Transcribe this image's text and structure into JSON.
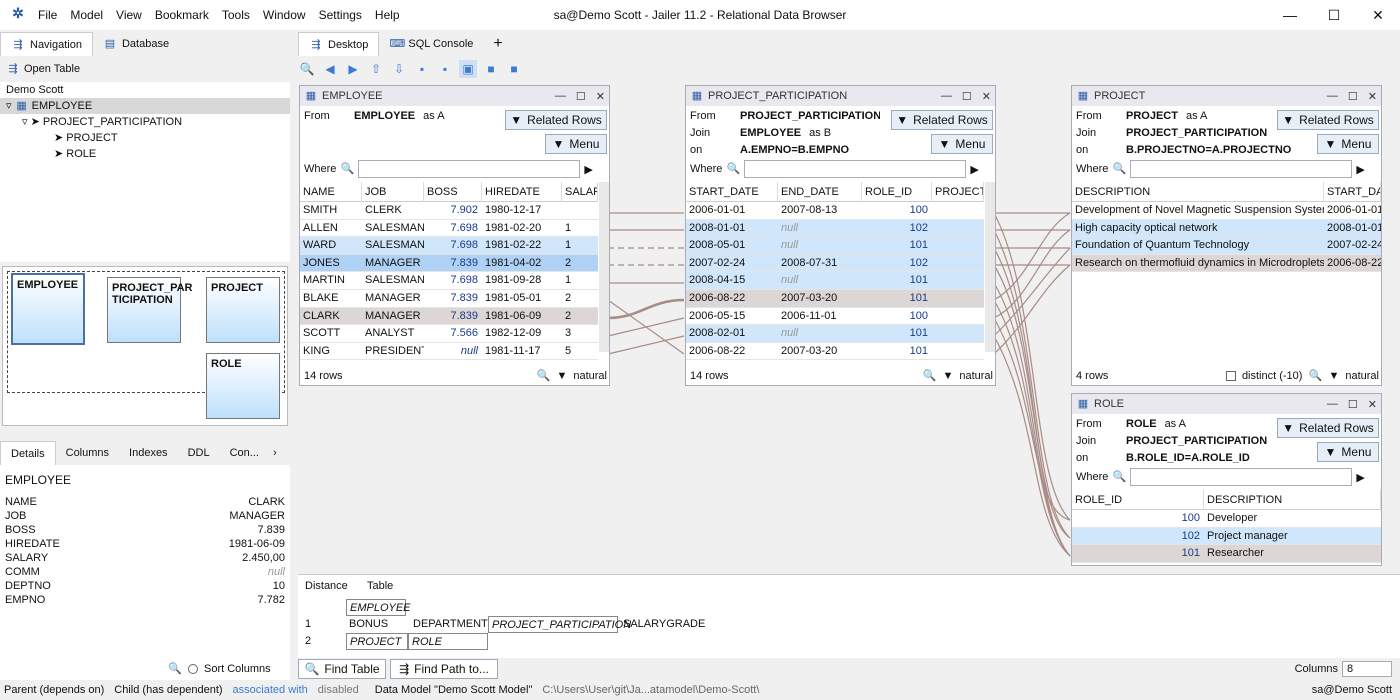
{
  "window": {
    "title": "sa@Demo Scott - Jailer 11.2 - Relational Data Browser",
    "menu": [
      "File",
      "Model",
      "View",
      "Bookmark",
      "Tools",
      "Window",
      "Settings",
      "Help"
    ],
    "min": "—",
    "max": "☐",
    "close": "✕"
  },
  "left_tabs": {
    "navigation": "Navigation",
    "database": "Database"
  },
  "open_table": "Open Table",
  "tree": {
    "root": "Demo Scott",
    "employee": "EMPLOYEE",
    "pp": "PROJECT_PARTICIPATION",
    "project": "PROJECT",
    "role": "ROLE"
  },
  "diagram": {
    "employee": "EMPLOYEE",
    "pp": "PROJECT_PAR TICIPATION",
    "project": "PROJECT",
    "role": "ROLE"
  },
  "detail_tabs": [
    "Details",
    "Columns",
    "Indexes",
    "DDL",
    "Con..."
  ],
  "details": {
    "title": "EMPLOYEE",
    "rows": [
      [
        "NAME",
        "CLARK"
      ],
      [
        "JOB",
        "MANAGER"
      ],
      [
        "BOSS",
        "7.839"
      ],
      [
        "HIREDATE",
        "1981-06-09"
      ],
      [
        "SALARY",
        "2.450,00"
      ],
      [
        "COMM",
        "null"
      ],
      [
        "DEPTNO",
        "10"
      ],
      [
        "EMPNO",
        "7.782"
      ]
    ],
    "sort_columns": "Sort Columns"
  },
  "desktop_tabs": {
    "desktop": "Desktop",
    "sql": "SQL Console",
    "add": "+"
  },
  "employee": {
    "title": "EMPLOYEE",
    "from_label": "From",
    "from": "EMPLOYEE",
    "alias": "as A",
    "related": "Related Rows",
    "menu": "Menu",
    "where": "Where",
    "cols": [
      "NAME",
      "JOB",
      "BOSS",
      "HIREDATE",
      "SALAR"
    ],
    "rows": [
      [
        "SMITH",
        "CLERK",
        "7.902",
        "1980-12-17",
        ""
      ],
      [
        "ALLEN",
        "SALESMAN",
        "7.698",
        "1981-02-20",
        "1"
      ],
      [
        "WARD",
        "SALESMAN",
        "7.698",
        "1981-02-22",
        "1"
      ],
      [
        "JONES",
        "MANAGER",
        "7.839",
        "1981-04-02",
        "2"
      ],
      [
        "MARTIN",
        "SALESMAN",
        "7.698",
        "1981-09-28",
        "1"
      ],
      [
        "BLAKE",
        "MANAGER",
        "7.839",
        "1981-05-01",
        "2"
      ],
      [
        "CLARK",
        "MANAGER",
        "7.839",
        "1981-06-09",
        "2"
      ],
      [
        "SCOTT",
        "ANALYST",
        "7.566",
        "1982-12-09",
        "3"
      ],
      [
        "KING",
        "PRESIDENT",
        "null",
        "1981-11-17",
        "5"
      ]
    ],
    "count": "14 rows",
    "natural": "natural"
  },
  "pp": {
    "title": "PROJECT_PARTICIPATION",
    "from_label": "From",
    "from": "PROJECT_PARTICIPATION",
    "join_label": "Join",
    "join": "EMPLOYEE",
    "join_alias": "as B",
    "on_label": "on",
    "on": "A.EMPNO=B.EMPNO",
    "related": "Related Rows",
    "menu": "Menu",
    "where": "Where",
    "cols": [
      "START_DATE",
      "END_DATE",
      "ROLE_ID",
      "PROJECTN"
    ],
    "rows": [
      [
        "2006-01-01",
        "2007-08-13",
        "100"
      ],
      [
        "2008-01-01",
        "null",
        "102"
      ],
      [
        "2008-05-01",
        "null",
        "101"
      ],
      [
        "2007-02-24",
        "2008-07-31",
        "102"
      ],
      [
        "2008-04-15",
        "null",
        "101"
      ],
      [
        "2006-08-22",
        "2007-03-20",
        "101"
      ],
      [
        "2006-05-15",
        "2006-11-01",
        "100"
      ],
      [
        "2008-02-01",
        "null",
        "101"
      ],
      [
        "2006-08-22",
        "2007-03-20",
        "101"
      ]
    ],
    "count": "14 rows",
    "natural": "natural"
  },
  "project": {
    "title": "PROJECT",
    "from_label": "From",
    "from": "PROJECT",
    "alias": "as A",
    "join_label": "Join",
    "join": "PROJECT_PARTICIPATION",
    "on_label": "on",
    "on": "B.PROJECTNO=A.PROJECTNO",
    "related": "Related Rows",
    "menu": "Menu",
    "where": "Where",
    "cols": [
      "DESCRIPTION",
      "START_DAT"
    ],
    "rows": [
      [
        "Development of Novel Magnetic Suspension System",
        "2006-01-01"
      ],
      [
        "High capacity optical network",
        "2008-01-01"
      ],
      [
        "Foundation of Quantum Technology",
        "2007-02-24"
      ],
      [
        "Research on thermofluid dynamics in Microdroplets",
        "2006-08-22"
      ]
    ],
    "count": "4 rows",
    "distinct": "distinct (-10)",
    "natural": "natural"
  },
  "role": {
    "title": "ROLE",
    "from_label": "From",
    "from": "ROLE",
    "alias": "as A",
    "join_label": "Join",
    "join": "PROJECT_PARTICIPATION",
    "on_label": "on",
    "on": "B.ROLE_ID=A.ROLE_ID",
    "related": "Related Rows",
    "menu": "Menu",
    "where": "Where",
    "cols": [
      "ROLE_ID",
      "DESCRIPTION"
    ],
    "rows": [
      [
        "100",
        "Developer"
      ],
      [
        "102",
        "Project manager"
      ],
      [
        "101",
        "Researcher"
      ]
    ]
  },
  "path": {
    "distance": "Distance",
    "table": "Table",
    "r0": "EMPLOYEE",
    "r1": [
      "1",
      "BONUS",
      "DEPARTMENT",
      "PROJECT_PARTICIPATION",
      "SALARYGRADE"
    ],
    "r2": [
      "2",
      "PROJECT",
      "ROLE"
    ],
    "find_table": "Find Table",
    "find_path": "Find Path to...",
    "columns_label": "Columns",
    "columns_value": "8"
  },
  "status": {
    "parent": "Parent (depends on)",
    "child": "Child (has dependent)",
    "assoc": "associated with",
    "disabled": "disabled",
    "model": "Data Model \"Demo Scott Model\"",
    "path": "C:\\Users\\User\\git\\Ja...atamodel\\Demo-Scott\\",
    "user": "sa@Demo Scott"
  },
  "colors": {
    "accent": "#3a7bd5",
    "selected": "#aed1f5",
    "highlight": "#cfe6fb",
    "grayrow": "#dcd6d4",
    "assoc": "#3a7bd5",
    "link": "#a98b85"
  }
}
